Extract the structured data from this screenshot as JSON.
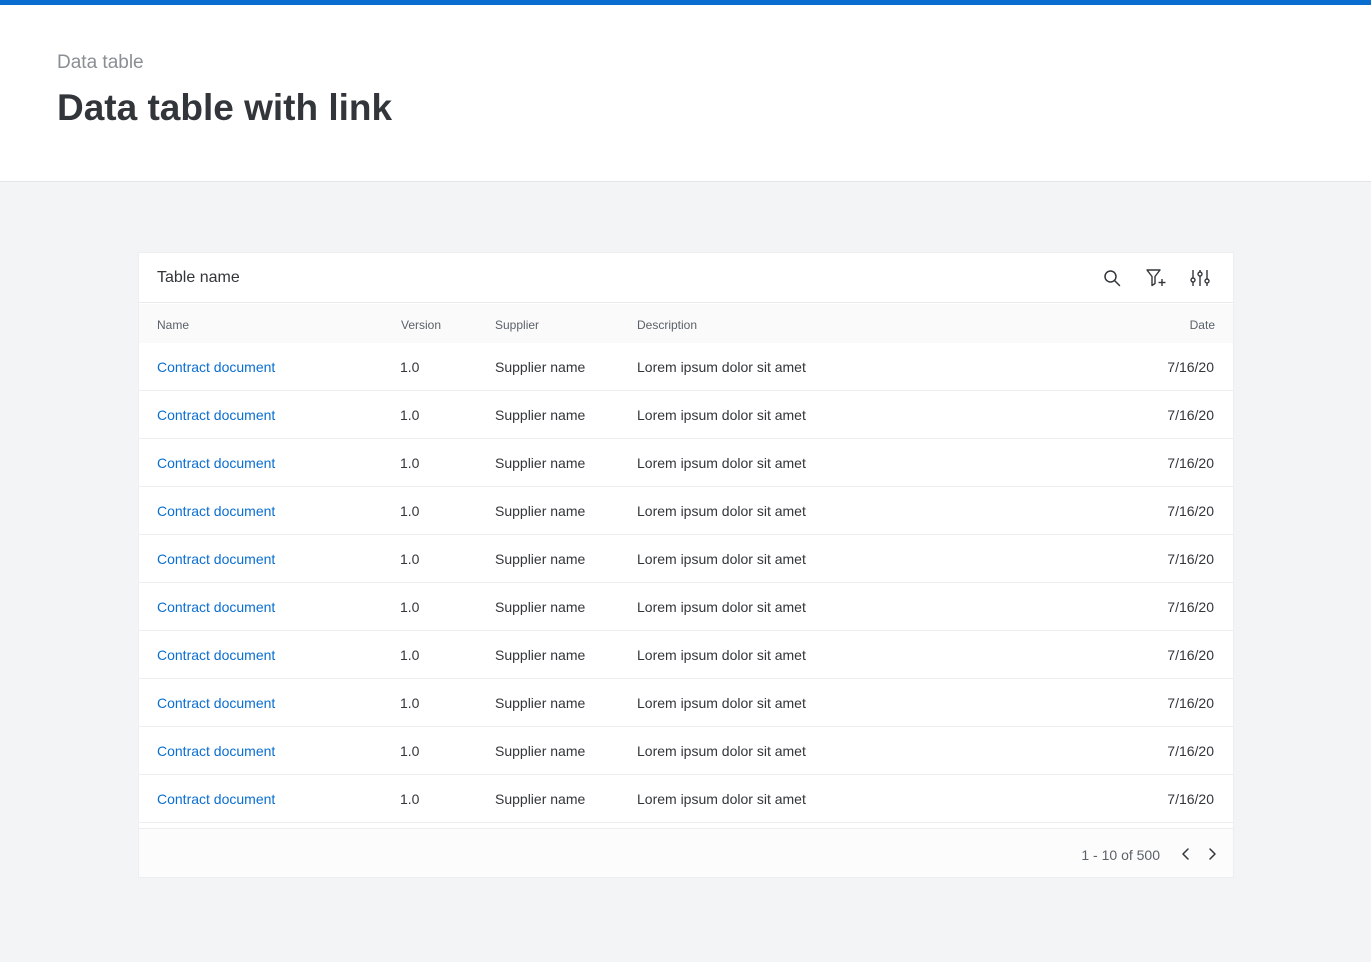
{
  "page": {
    "breadcrumb": "Data table",
    "title": "Data table with link"
  },
  "colors": {
    "accent": "#0a6ed1",
    "text": "#32363a",
    "muted": "#8a8f94",
    "background": "#f3f4f5"
  },
  "table": {
    "name": "Table name",
    "toolbar": {
      "icons": [
        "search-icon",
        "filter-add-icon",
        "settings-sliders-icon"
      ]
    },
    "columns": [
      "Name",
      "Version",
      "Supplier",
      "Description",
      "Date"
    ],
    "rows": [
      {
        "name": "Contract document",
        "version": "1.0",
        "supplier": "Supplier name",
        "description": "Lorem ipsum dolor sit amet",
        "date": "7/16/20"
      },
      {
        "name": "Contract document",
        "version": "1.0",
        "supplier": "Supplier name",
        "description": "Lorem ipsum dolor sit amet",
        "date": "7/16/20"
      },
      {
        "name": "Contract document",
        "version": "1.0",
        "supplier": "Supplier name",
        "description": "Lorem ipsum dolor sit amet",
        "date": "7/16/20"
      },
      {
        "name": "Contract document",
        "version": "1.0",
        "supplier": "Supplier name",
        "description": "Lorem ipsum dolor sit amet",
        "date": "7/16/20"
      },
      {
        "name": "Contract document",
        "version": "1.0",
        "supplier": "Supplier name",
        "description": "Lorem ipsum dolor sit amet",
        "date": "7/16/20"
      },
      {
        "name": "Contract document",
        "version": "1.0",
        "supplier": "Supplier name",
        "description": "Lorem ipsum dolor sit amet",
        "date": "7/16/20"
      },
      {
        "name": "Contract document",
        "version": "1.0",
        "supplier": "Supplier name",
        "description": "Lorem ipsum dolor sit amet",
        "date": "7/16/20"
      },
      {
        "name": "Contract document",
        "version": "1.0",
        "supplier": "Supplier name",
        "description": "Lorem ipsum dolor sit amet",
        "date": "7/16/20"
      },
      {
        "name": "Contract document",
        "version": "1.0",
        "supplier": "Supplier name",
        "description": "Lorem ipsum dolor sit amet",
        "date": "7/16/20"
      },
      {
        "name": "Contract document",
        "version": "1.0",
        "supplier": "Supplier name",
        "description": "Lorem ipsum dolor sit amet",
        "date": "7/16/20"
      }
    ],
    "pagination": {
      "label": "1 - 10 of 500"
    }
  }
}
